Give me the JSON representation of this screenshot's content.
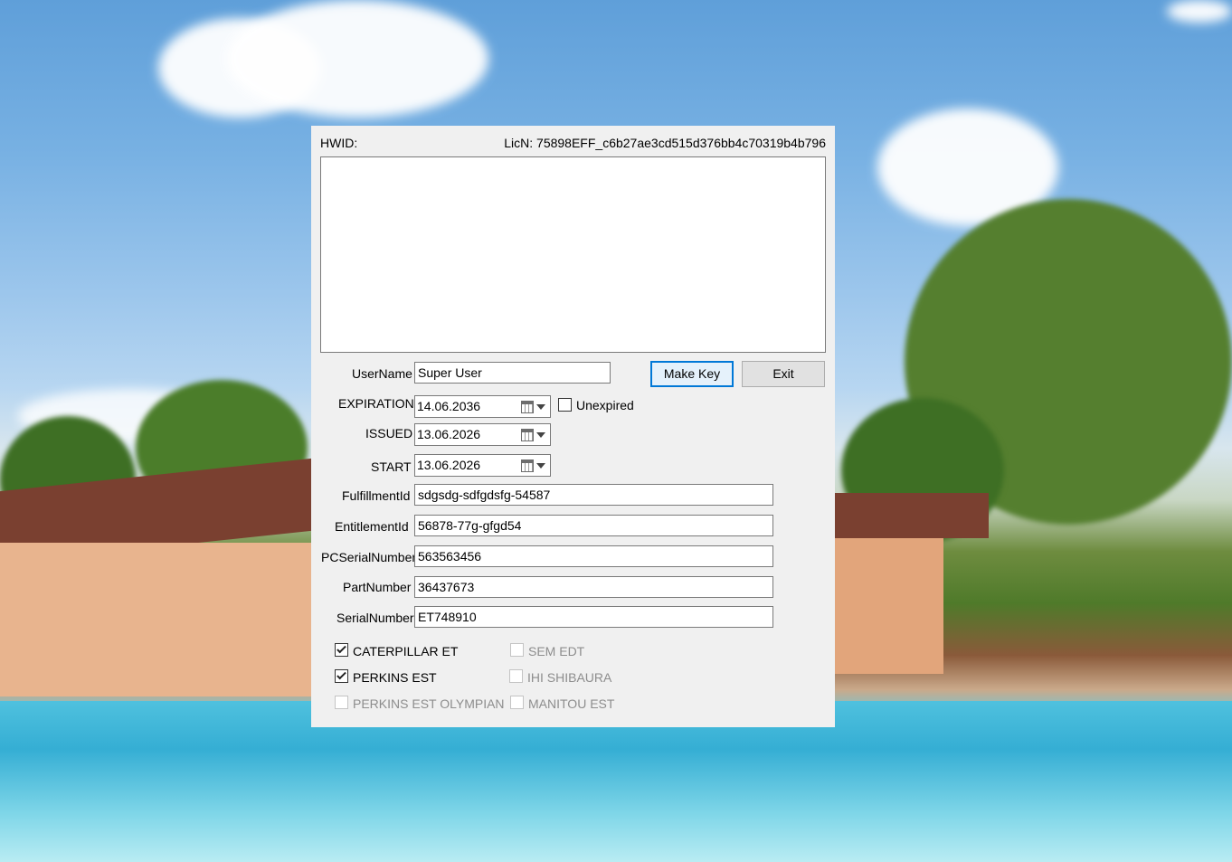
{
  "dialog": {
    "hwid_label": "HWID:",
    "licn_text": "LicN: 75898EFF_c6b27ae3cd515d376bb4c70319b4b796",
    "hwid_value": ""
  },
  "fields": {
    "username": {
      "label": "UserName",
      "value": "Super User"
    },
    "expiration": {
      "label": "EXPIRATION",
      "value": "14.06.2036"
    },
    "issued": {
      "label": "ISSUED",
      "value": "13.06.2026"
    },
    "start": {
      "label": "START",
      "value": "13.06.2026"
    },
    "fulfillment": {
      "label": "FulfillmentId",
      "value": "sdgsdg-sdfgdsfg-54587"
    },
    "entitlement": {
      "label": "EntitlementId",
      "value": "56878-77g-gfgd54"
    },
    "pcserial": {
      "label": "PCSerialNumber",
      "value": "563563456"
    },
    "partnumber": {
      "label": "PartNumber",
      "value": "36437673"
    },
    "serialnumber": {
      "label": "SerialNumber",
      "value": "ET748910"
    }
  },
  "buttons": {
    "make_key": "Make Key",
    "exit": "Exit"
  },
  "unexpired": {
    "label": "Unexpired",
    "checked": false
  },
  "options": [
    {
      "label": "CATERPILLAR ET",
      "checked": true,
      "enabled": true
    },
    {
      "label": "PERKINS EST",
      "checked": true,
      "enabled": true
    },
    {
      "label": "PERKINS EST OLYMPIAN",
      "checked": false,
      "enabled": false
    },
    {
      "label": "SEM EDT",
      "checked": false,
      "enabled": false
    },
    {
      "label": "IHI SHIBAURA",
      "checked": false,
      "enabled": false
    },
    {
      "label": "MANITOU EST",
      "checked": false,
      "enabled": false
    }
  ],
  "icons": {
    "calendar": "calendar-icon",
    "dropdown": "chevron-down-icon",
    "check": "checkmark-icon"
  }
}
